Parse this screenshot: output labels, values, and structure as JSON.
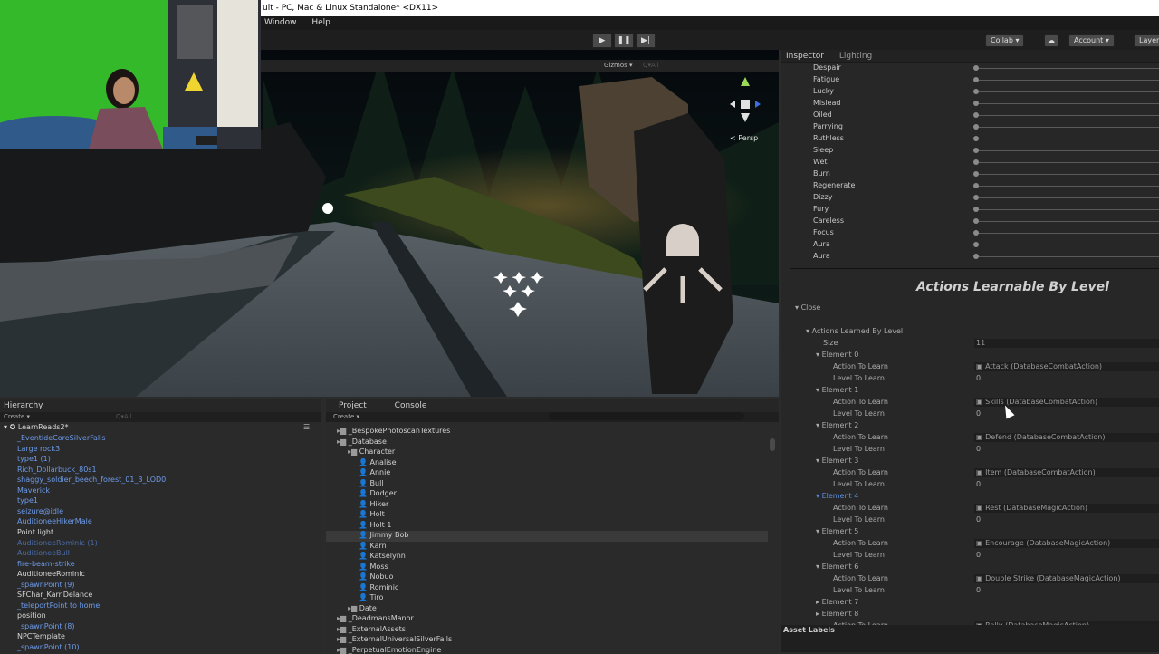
{
  "window": {
    "title": "ult - PC, Mac & Linux Standalone* <DX11>"
  },
  "menu": [
    "Window",
    "Help"
  ],
  "toolbar": {
    "collab": "Collab ▾",
    "account": "Account ▾",
    "layers": "Layer"
  },
  "scene": {
    "gizmos": "Gizmos ▾",
    "search": "Q▾All",
    "persp": "< Persp"
  },
  "hierarchy": {
    "tab": "Hierarchy",
    "create": "Create ▾",
    "search": "Q▾All",
    "scene": "LearnReads2*",
    "items": [
      {
        "t": "_EventideCoreSilverFalls",
        "c": "blue"
      },
      {
        "t": "Large rock3",
        "c": "blue"
      },
      {
        "t": "type1 (1)",
        "c": "blue"
      },
      {
        "t": "Rich_Dollarbuck_80s1",
        "c": "blue"
      },
      {
        "t": "shaggy_soldier_beech_forest_01_3_LOD0",
        "c": "blue"
      },
      {
        "t": "Maverick",
        "c": "blue"
      },
      {
        "t": "type1",
        "c": "blue"
      },
      {
        "t": "seizure@idle",
        "c": "blue"
      },
      {
        "t": "AuditioneeHikerMale",
        "c": "blue"
      },
      {
        "t": "Point light",
        "c": "white"
      },
      {
        "t": "AuditioneeRominic (1)",
        "c": "dimblue"
      },
      {
        "t": "AuditioneeBull",
        "c": "dimblue"
      },
      {
        "t": "fire-beam-strike",
        "c": "blue"
      },
      {
        "t": "AuditioneeRominic",
        "c": "white"
      },
      {
        "t": "_spawnPoint (9)",
        "c": "blue"
      },
      {
        "t": "SFChar_KarnDelance",
        "c": "white"
      },
      {
        "t": "_teleportPoint to home",
        "c": "blue"
      },
      {
        "t": "position",
        "c": "white"
      },
      {
        "t": "_spawnPoint (8)",
        "c": "blue"
      },
      {
        "t": "NPCTemplate",
        "c": "white"
      },
      {
        "t": "_spawnPoint (10)",
        "c": "blue"
      }
    ]
  },
  "project": {
    "tab": "Project",
    "console_tab": "Console",
    "create": "Create ▾",
    "folders": [
      {
        "t": "_BespokePhotoscanTextures",
        "lvl": 0
      },
      {
        "t": "_Database",
        "lvl": 0
      },
      {
        "t": "Character",
        "lvl": 1
      },
      {
        "t": "Analise",
        "lvl": 2
      },
      {
        "t": "Annie",
        "lvl": 2
      },
      {
        "t": "Bull",
        "lvl": 2
      },
      {
        "t": "Dodger",
        "lvl": 2
      },
      {
        "t": "Hiker",
        "lvl": 2
      },
      {
        "t": "Holt",
        "lvl": 2
      },
      {
        "t": "Holt 1",
        "lvl": 2
      },
      {
        "t": "Jimmy Bob",
        "lvl": 2
      },
      {
        "t": "Karn",
        "lvl": 2
      },
      {
        "t": "Katselynn",
        "lvl": 2
      },
      {
        "t": "Moss",
        "lvl": 2
      },
      {
        "t": "Nobuo",
        "lvl": 2
      },
      {
        "t": "Rominic",
        "lvl": 2
      },
      {
        "t": "Tiro",
        "lvl": 2
      },
      {
        "t": "Date",
        "lvl": 1
      },
      {
        "t": "_DeadmansManor",
        "lvl": 0
      },
      {
        "t": "_ExternalAssets",
        "lvl": 0
      },
      {
        "t": "_ExternalUniversalSilverFalls",
        "lvl": 0
      },
      {
        "t": "_PerpetualEmotionEngine",
        "lvl": 0
      }
    ]
  },
  "inspector": {
    "tab": "Inspector",
    "lighting_tab": "Lighting",
    "statuses": [
      "Despair",
      "Fatigue",
      "Lucky",
      "Mislead",
      "Oiled",
      "Parrying",
      "Ruthless",
      "Sleep",
      "Wet",
      "Burn",
      "Regenerate",
      "Dizzy",
      "Fury",
      "Careless",
      "Focus",
      "Aura",
      "Aura"
    ],
    "section_title": "Actions Learnable By Level",
    "close": "Close",
    "actions_label": "Actions Learned By Level",
    "size_label": "Size",
    "size_value": "11",
    "action_label": "Action To Learn",
    "level_label": "Level To Learn",
    "elements": [
      {
        "name": "Element 0",
        "action": "Attack (DatabaseCombatAction)",
        "level": "0"
      },
      {
        "name": "Element 1",
        "action": "Skills (DatabaseCombatAction)",
        "level": "0"
      },
      {
        "name": "Element 2",
        "action": "Defend (DatabaseCombatAction)",
        "level": "0"
      },
      {
        "name": "Element 3",
        "action": "Item (DatabaseCombatAction)",
        "level": "0"
      },
      {
        "name": "Element 4",
        "action": "Rest (DatabaseMagicAction)",
        "level": "0"
      },
      {
        "name": "Element 5",
        "action": "Encourage (DatabaseMagicAction)",
        "level": "0"
      },
      {
        "name": "Element 6",
        "action": "Double Strike (DatabaseMagicAction)",
        "level": "0"
      }
    ],
    "more": [
      {
        "name": "Element 7"
      },
      {
        "name": "Element 8"
      }
    ],
    "more_action": "Action To Learn",
    "more_action_value": "Rally (DatabaseMagicAction)",
    "asset_labels": "Asset Labels"
  }
}
